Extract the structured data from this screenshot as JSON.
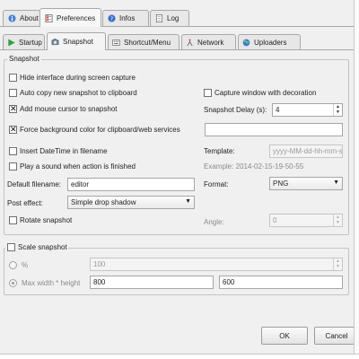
{
  "top_tabs": [
    {
      "label": "About",
      "icon": "info-icon"
    },
    {
      "label": "Preferences",
      "icon": "preferences-icon"
    },
    {
      "label": "Infos",
      "icon": "question-icon"
    },
    {
      "label": "Log",
      "icon": "log-icon"
    }
  ],
  "sub_tabs": [
    {
      "label": "Startup",
      "icon": "play-icon"
    },
    {
      "label": "Snapshot",
      "icon": "camera-icon"
    },
    {
      "label": "Shortcut/Menu",
      "icon": "shortcut-icon"
    },
    {
      "label": "Network",
      "icon": "network-icon"
    },
    {
      "label": "Uploaders",
      "icon": "uploaders-icon"
    }
  ],
  "snapshot": {
    "group_label": "Snapshot",
    "hide_interface": {
      "label": "Hide interface during screen capture",
      "checked": false
    },
    "auto_copy": {
      "label": "Auto copy new snapshot to clipboard",
      "checked": false
    },
    "capture_decoration": {
      "label": "Capture window with decoration",
      "checked": false
    },
    "add_mouse_cursor": {
      "label": "Add mouse cursor to snapshot",
      "checked": true
    },
    "delay_label": "Snapshot Delay (s):",
    "delay_value": "4",
    "force_bg": {
      "label": "Force background color for clipboard/web services",
      "checked": true
    },
    "insert_datetime": {
      "label": "Insert DateTime in filename",
      "checked": false
    },
    "template_label": "Template:",
    "template_placeholder": "yyyy-MM-dd-hh-mm-ss",
    "play_sound": {
      "label": "Play a sound when action is finished",
      "checked": false
    },
    "example_text": "Example: 2014-02-15-19-50-55",
    "default_filename_label": "Default filename:",
    "default_filename_value": "editor",
    "format_label": "Format:",
    "format_value": "PNG",
    "post_effect_label": "Post effect:",
    "post_effect_value": "Simple drop shadow",
    "rotate": {
      "label": "Rotate snapshot",
      "checked": false
    },
    "angle_label": "Angle:",
    "angle_value": "0"
  },
  "scale": {
    "group_label": "Scale snapshot",
    "checked": false,
    "percent_label": "%",
    "percent_value": "100",
    "max_label": "Max width * height",
    "max_width": "800",
    "max_height": "600"
  },
  "buttons": {
    "ok": "OK",
    "cancel": "Cancel"
  }
}
